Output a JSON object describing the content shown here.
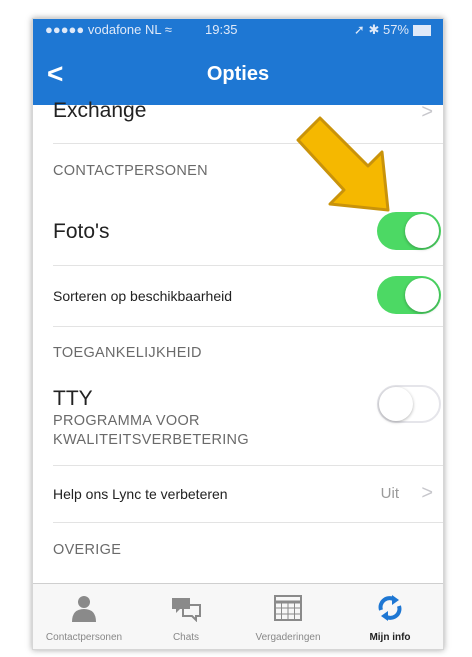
{
  "status": {
    "carrier": "vodafone NL",
    "time": "19:35",
    "battery": "57%"
  },
  "nav": {
    "title": "Opties",
    "back_glyph": "<"
  },
  "rows": {
    "exchange": "Exchange",
    "sec_contacts": "CONTACTPERSONEN",
    "photos": "Foto's",
    "sort": "Sorteren op beschikbaarheid",
    "sec_access": "TOEGANKELIJKHEID",
    "tty": "TTY",
    "sec_program_1": "PROGRAMMA VOOR",
    "sec_program_2": "KWALITEITSVERBETERING",
    "help": "Help ons Lync te verbeteren",
    "help_value": "Uit",
    "sec_other": "OVERIGE"
  },
  "toggles": {
    "photos": true,
    "sort": true,
    "tty": false
  },
  "tabbar": {
    "tabs": [
      {
        "label": "Contactpersonen",
        "icon": "person-icon",
        "active": false
      },
      {
        "label": "Chats",
        "icon": "chat-bubbles-icon",
        "active": false
      },
      {
        "label": "Vergaderingen",
        "icon": "calendar-icon",
        "active": false
      },
      {
        "label": "Mijn info",
        "icon": "sync-arrows-icon",
        "active": true
      }
    ]
  },
  "colors": {
    "accent": "#1e77d3",
    "toggle_on": "#4cd964",
    "annotation_arrow": "#f5b800"
  }
}
